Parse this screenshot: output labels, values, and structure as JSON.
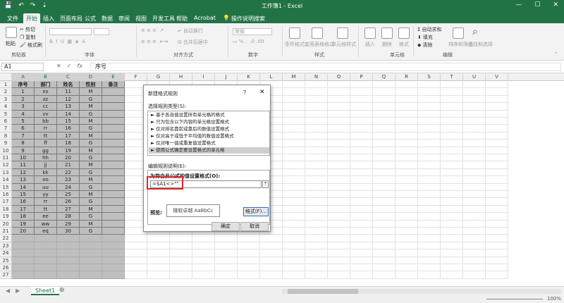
{
  "titlebar": {
    "title": "工作簿1 - Excel",
    "qa_save": "💾",
    "qa_undo": "↶",
    "qa_redo": "↷",
    "qa_more": "⇣",
    "min": "—",
    "max": "☐",
    "close": "✕"
  },
  "menu": {
    "tabs": [
      "文件",
      "开始",
      "插入",
      "页面布局",
      "公式",
      "数据",
      "审阅",
      "视图",
      "开发工具",
      "帮助",
      "Acrobat"
    ],
    "search_hint": "操作说明搜索",
    "active_index": 1
  },
  "ribbon": {
    "cut": "剪切",
    "copy": "复制",
    "format_painter": "格式刷",
    "paste": "粘贴",
    "group_clipboard": "剪贴板",
    "group_font": "字体",
    "wrap_text": "自动换行",
    "merge_center": "合并后居中",
    "group_alignment": "对齐方式",
    "group_number": "数字",
    "number_format": "常规",
    "conditional_format": "条件格式",
    "table_format": "套用表格格式",
    "cell_styles": "单元格样式",
    "group_styles": "样式",
    "insert": "插入",
    "delete": "删除",
    "format": "格式",
    "group_cells": "单元格",
    "autosum": "自动求和",
    "fill": "填充",
    "clear": "清除",
    "sort_filter": "排序和筛选",
    "find_select": "查找和选择",
    "group_editing": "编辑"
  },
  "formula_bar": {
    "name_box": "A1",
    "cancel": "✕",
    "enter": "✓",
    "fx": "fx",
    "value": "序号"
  },
  "columns": [
    "A",
    "B",
    "C",
    "D",
    "E",
    "F",
    "G",
    "H",
    "I",
    "J",
    "K",
    "L",
    "M",
    "N",
    "O",
    "P",
    "Q",
    "R",
    "S",
    "T",
    "U",
    "V"
  ],
  "rows": [
    "1",
    "2",
    "3",
    "4",
    "5",
    "6",
    "7",
    "8",
    "9",
    "10",
    "11",
    "12",
    "13",
    "14",
    "15",
    "16",
    "17",
    "18",
    "19",
    "20",
    "21",
    "22",
    "23",
    "24",
    "25",
    "26",
    "27"
  ],
  "table": {
    "headers": [
      "序号",
      "部门",
      "姓名",
      "性别",
      "备注"
    ],
    "body": [
      [
        "1",
        "xx",
        "11",
        "M"
      ],
      [
        "2",
        "zz",
        "12",
        "G"
      ],
      [
        "3",
        "cc",
        "13",
        "M"
      ],
      [
        "4",
        "vv",
        "14",
        "G"
      ],
      [
        "5",
        "bb",
        "15",
        "M"
      ],
      [
        "6",
        "rr",
        "16",
        "G"
      ],
      [
        "7",
        "tt",
        "17",
        "M"
      ],
      [
        "8",
        "ff",
        "18",
        "G"
      ],
      [
        "9",
        "gg",
        "19",
        "M"
      ],
      [
        "10",
        "hh",
        "20",
        "G"
      ],
      [
        "11",
        "jj",
        "21",
        "M"
      ],
      [
        "12",
        "kk",
        "22",
        "G"
      ],
      [
        "13",
        "oo",
        "23",
        "M"
      ],
      [
        "14",
        "uu",
        "24",
        "G"
      ],
      [
        "15",
        "yy",
        "25",
        "M"
      ],
      [
        "16",
        "rr",
        "26",
        "G"
      ],
      [
        "17",
        "tt",
        "27",
        "M"
      ],
      [
        "18",
        "ee",
        "28",
        "G"
      ],
      [
        "19",
        "ww",
        "29",
        "M"
      ],
      [
        "20",
        "eq",
        "30",
        "G"
      ]
    ]
  },
  "sheets": {
    "active": "Sheet1",
    "add": "⊕",
    "prev": "◀",
    "next": "▶"
  },
  "status": {
    "zoom": "100%"
  },
  "dialog": {
    "title": "新建格式规则",
    "help": "?",
    "close": "✕",
    "select_type_label": "选择规则类型(S):",
    "rule_types": [
      "► 基于各自值设置所有单元格的格式",
      "► 只为包含以下内容的单元格设置格式",
      "► 仅对排名靠前或靠后的数值设置格式",
      "► 仅对高于或低于平均值的数值设置格式",
      "► 仅对唯一值或重复值设置格式",
      "► 使用公式确定要设置格式的单元格"
    ],
    "selected_rule_index": 5,
    "edit_label": "编辑规则说明(E):",
    "formula_title": "为符合此公式的值设置格式(O):",
    "formula_value": "=$A1<>\"\"",
    "collapse": "⇡",
    "preview_label": "预览:",
    "preview_text": "微软卓越  AaBbCc",
    "format_button": "格式(F)...",
    "ok": "确定",
    "cancel": "取消"
  }
}
